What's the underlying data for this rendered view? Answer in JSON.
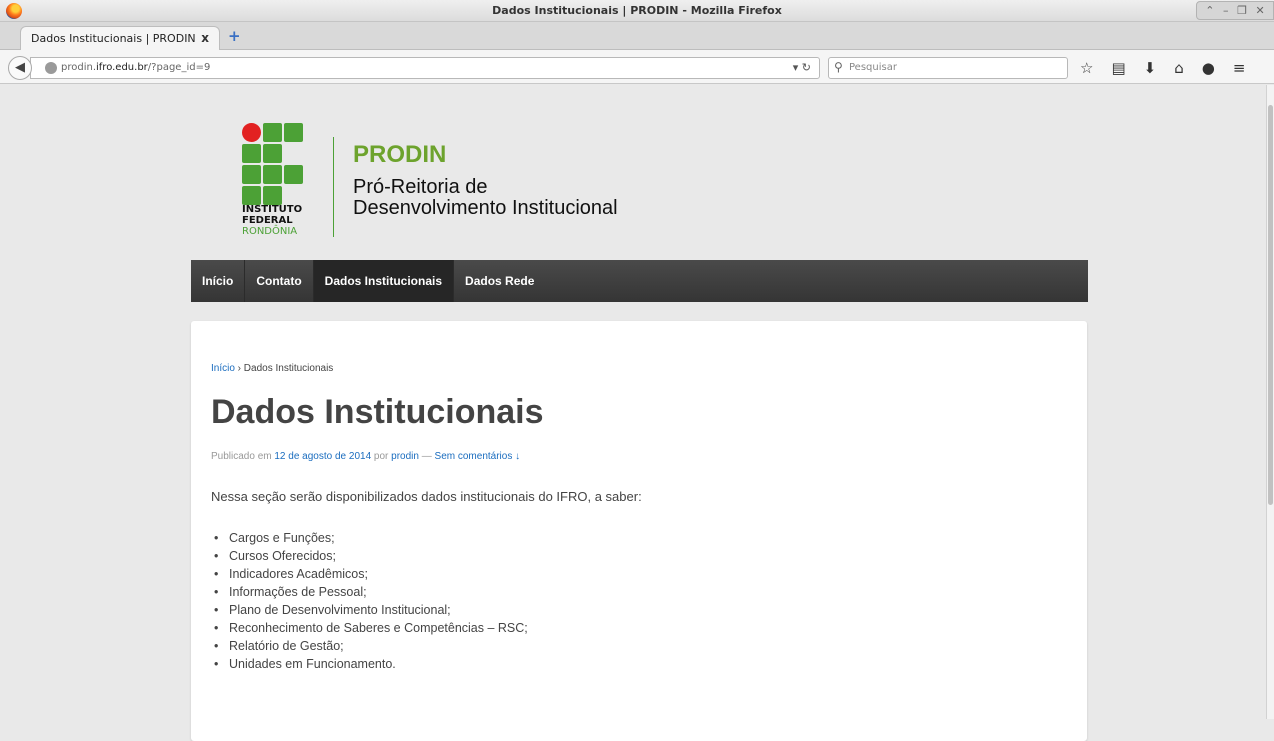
{
  "window": {
    "title": "Dados Institucionais | PRODIN - Mozilla Firefox"
  },
  "tab": {
    "label": "Dados Institucionais | PRODIN",
    "close": "x",
    "new_tab": "+"
  },
  "nav": {
    "url_host": "prodin.ifro.edu.br",
    "url_prefix": "prodin.",
    "url_domain": "ifro.edu.br",
    "url_path": "/?page_id=9",
    "search_placeholder": "Pesquisar"
  },
  "site": {
    "logo_line1": "INSTITUTO",
    "logo_line2": "FEDERAL",
    "logo_line3": "RONDÔNIA",
    "brand": "PRODIN",
    "tagline1": "Pró-Reitoria de",
    "tagline2": "Desenvolvimento Institucional",
    "menu": [
      "Início",
      "Contato",
      "Dados Institucionais",
      "Dados Rede"
    ]
  },
  "post": {
    "breadcrumb_home": "Início",
    "breadcrumb_sep": " › ",
    "breadcrumb_current": "Dados Institucionais",
    "title": "Dados Institucionais",
    "meta_published": "Publicado em ",
    "meta_date": "12 de agosto de 2014",
    "meta_by": " por ",
    "meta_author": "prodin",
    "meta_dash": " — ",
    "meta_comments": "Sem comentários ↓",
    "intro": "Nessa seção serão disponibilizados dados institucionais do IFRO, a saber:",
    "items": [
      "Cargos e Funções;",
      "Cursos Oferecidos;",
      "Indicadores Acadêmicos;",
      "Informações de Pessoal;",
      "Plano de Desenvolvimento Institucional;",
      "Reconhecimento de Saberes e Competências – RSC;",
      "Relatório de Gestão;",
      "Unidades em Funcionamento."
    ]
  }
}
